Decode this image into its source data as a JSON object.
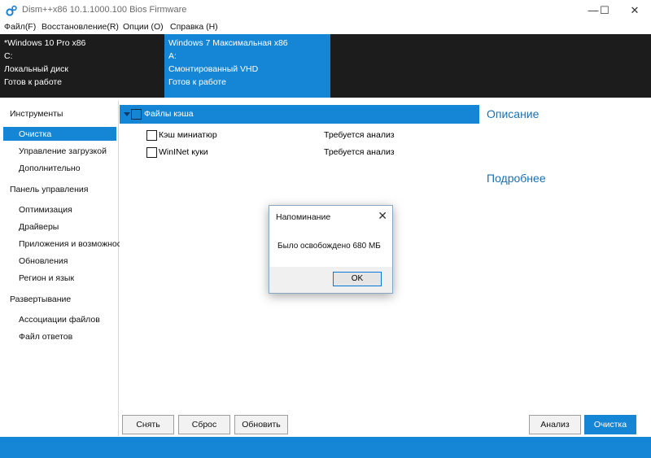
{
  "window": {
    "title": "Dism++x86 10.1.1000.100 Bios Firmware",
    "icon": "gears-icon",
    "controls": {
      "minimize": "—",
      "maximize": "☐",
      "close": "✕"
    }
  },
  "menu": [
    "Файл(F)",
    "Восстановление(R)",
    "Опции (О)",
    "Справка (Н)"
  ],
  "sessions": [
    {
      "lines": [
        "*Windows 10 Pro x86",
        "C:",
        "Локальный диск",
        "Готов к работе"
      ],
      "active": false
    },
    {
      "lines": [
        "Windows 7 Максимальная x86",
        "A:",
        "Смонтированный VHD",
        "Готов к работе"
      ],
      "active": true
    }
  ],
  "sidebar": {
    "sections": [
      {
        "label": "Инструменты",
        "items": [
          "Очистка",
          "Управление загрузкой",
          "Дополнительно"
        ]
      },
      {
        "label": "Панель управления",
        "items": [
          "Оптимизация",
          "Драйверы",
          "Приложения и возможнос",
          "Обновления",
          "Регион и язык"
        ]
      },
      {
        "label": "Развертывание",
        "items": [
          "Ассоциации файлов",
          "Файл ответов"
        ]
      }
    ],
    "selected": "Очистка"
  },
  "cleanup": {
    "group": "Файлы кэша",
    "rows": [
      {
        "label": "Кэш миниатюр",
        "status": "Требуется анализ"
      },
      {
        "label": "WinINet куки",
        "status": "Требуется анализ"
      }
    ]
  },
  "right_panel": {
    "description_title": "Описание",
    "details_title": "Подробнее"
  },
  "buttons": {
    "uncheck": "Снять",
    "reset": "Сброс",
    "refresh": "Обновить",
    "analyze": "Анализ",
    "clean": "Очистка"
  },
  "dialog": {
    "title": "Напоминание",
    "message": "Было освобождено 680 МБ",
    "ok": "OK",
    "close": "✕"
  },
  "colors": {
    "accent": "#1585d6",
    "dark": "#1c1c1c",
    "link": "#1a6fb3"
  }
}
